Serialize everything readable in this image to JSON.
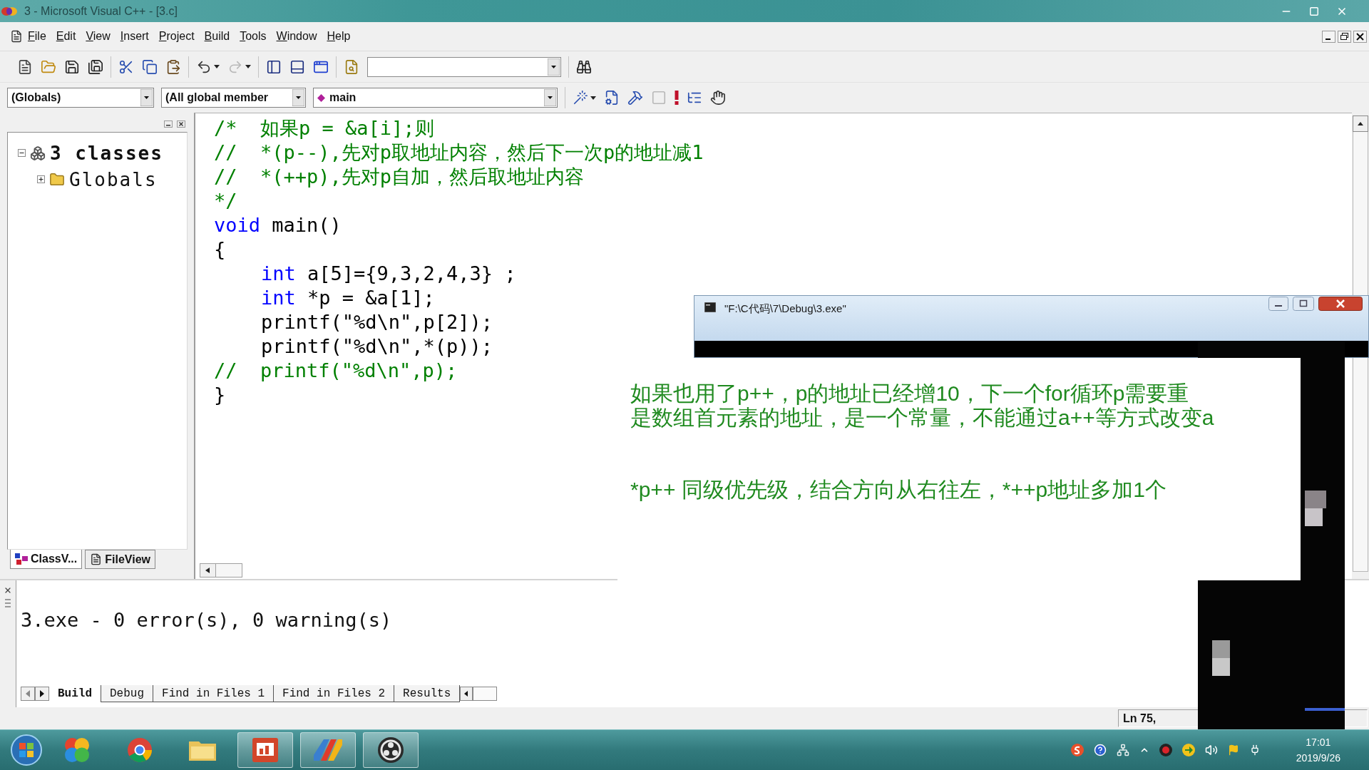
{
  "window": {
    "title": "3 - Microsoft Visual C++ - [3.c]"
  },
  "menu": [
    "File",
    "Edit",
    "View",
    "Insert",
    "Project",
    "Build",
    "Tools",
    "Window",
    "Help"
  ],
  "standard_toolbar": [
    [
      {
        "kind": "new",
        "disabled": false
      },
      {
        "kind": "open",
        "disabled": false
      },
      {
        "kind": "save",
        "disabled": false
      },
      {
        "kind": "save_all",
        "disabled": false
      }
    ],
    [
      {
        "kind": "cut",
        "disabled": false
      },
      {
        "kind": "copy",
        "disabled": false
      },
      {
        "kind": "paste",
        "disabled": false
      }
    ],
    [
      {
        "kind": "undo",
        "disabled": false
      },
      {
        "kind": "redo",
        "disabled": true
      }
    ],
    [
      {
        "kind": "workspace",
        "disabled": false
      },
      {
        "kind": "output",
        "disabled": false
      },
      {
        "kind": "windows",
        "disabled": false
      }
    ],
    [
      {
        "kind": "find_in_files",
        "disabled": false
      },
      {
        "kind": "find_combo",
        "disabled": false
      }
    ],
    [
      {
        "kind": "find",
        "disabled": false
      }
    ]
  ],
  "wizard_bar": {
    "combos": [
      {
        "kind": "scope",
        "value": "(Globals)"
      },
      {
        "kind": "filter",
        "value": "(All global member"
      },
      {
        "kind": "member",
        "value": "main"
      }
    ],
    "buttons": [
      {
        "kind": "wizard",
        "disabled": false
      },
      {
        "kind": "compile",
        "disabled": false
      },
      {
        "kind": "build",
        "disabled": false
      },
      {
        "kind": "stop",
        "disabled": true
      },
      {
        "kind": "execute",
        "disabled": false
      },
      {
        "kind": "step",
        "disabled": false
      },
      {
        "kind": "breakpoint",
        "disabled": false
      }
    ]
  },
  "class_view": {
    "tree": [
      {
        "label": "3 classes",
        "kind": "classes",
        "expanded": true,
        "children": [
          {
            "label": "Globals",
            "kind": "folder",
            "expanded": false
          }
        ]
      }
    ],
    "tabs": [
      {
        "label": "ClassV...",
        "kind": "classes",
        "selected": true
      },
      {
        "label": "FileView",
        "kind": "files",
        "selected": false
      }
    ]
  },
  "editor": {
    "lines": [
      {
        "segments": [
          {
            "kind": "comment",
            "text": "/*  如果p = &a[i];则"
          }
        ]
      },
      {
        "segments": [
          {
            "kind": "comment",
            "text": "//  *(p--),先对p取地址内容，然后下一次p的地址减1"
          }
        ]
      },
      {
        "segments": [
          {
            "kind": "comment",
            "text": "//  *(++p),先对p自加，然后取地址内容"
          }
        ]
      },
      {
        "segments": [
          {
            "kind": "comment",
            "text": "*/"
          }
        ]
      },
      {
        "segments": [
          {
            "kind": "keyword",
            "text": "void"
          },
          {
            "kind": "plain",
            "text": " main()"
          }
        ]
      },
      {
        "segments": [
          {
            "kind": "plain",
            "text": "{"
          }
        ],
        "children": [
          {
            "segments": [
              {
                "kind": "keyword",
                "text": "int"
              },
              {
                "kind": "plain",
                "text": " a[5]={9,3,2,4,3} ;"
              }
            ]
          },
          {
            "segments": [
              {
                "kind": "keyword",
                "text": "int"
              },
              {
                "kind": "plain",
                "text": " *p = &a[1];"
              }
            ]
          },
          {
            "segments": [
              {
                "kind": "plain",
                "text": "printf(\"%d\\n\",p[2]);"
              }
            ]
          },
          {
            "segments": [
              {
                "kind": "plain",
                "text": "printf(\"%d\\n\",*(p));"
              }
            ]
          }
        ]
      },
      {
        "segments": [
          {
            "kind": "comment",
            "text": "//  printf(\"%d\\n\",p);"
          }
        ]
      },
      {
        "segments": [
          {
            "kind": "plain",
            "text": "}"
          }
        ]
      }
    ]
  },
  "console_window": {
    "title": "\"F:\\C代码\\7\\Debug\\3.exe\""
  },
  "annotation": {
    "blocks": [
      {
        "lines": [
          "如果也用了p++，p的地址已经增10，下一个for循环p需要重",
          "是数组首元素的地址，是一个常量，不能通过a++等方式改变a"
        ]
      },
      {
        "lines": [
          "*p++  同级优先级，结合方向从右往左，*++p地址多加1个"
        ]
      }
    ]
  },
  "output": {
    "message": "3.exe - 0 error(s), 0 warning(s)",
    "tabs": [
      {
        "label": "Build",
        "selected": true
      },
      {
        "label": "Debug",
        "selected": false
      },
      {
        "label": "Find in Files 1",
        "selected": false
      },
      {
        "label": "Find in Files 2",
        "selected": false
      },
      {
        "label": "Results",
        "selected": false
      }
    ]
  },
  "status_bar": {
    "position": "Ln 75,"
  },
  "taskbar": {
    "apps": [
      {
        "kind": "petals",
        "running": false
      },
      {
        "kind": "browser",
        "running": false
      },
      {
        "kind": "folder",
        "running": false
      },
      {
        "kind": "slides",
        "running": true
      },
      {
        "kind": "stripes",
        "running": true
      },
      {
        "kind": "aperture",
        "running": true
      }
    ],
    "time": "17:01",
    "date": "2019/9/26"
  }
}
